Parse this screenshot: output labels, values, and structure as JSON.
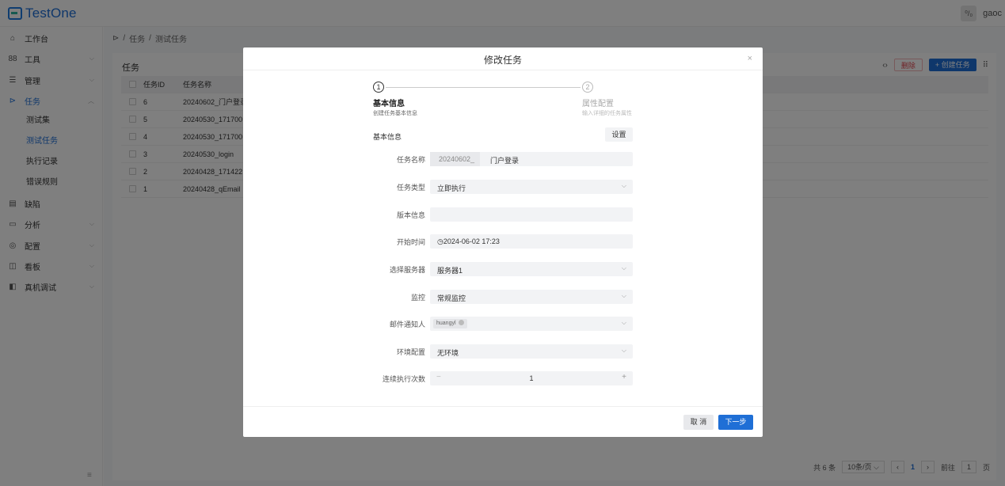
{
  "app": {
    "name": "TestOne",
    "user_avatar": "⁰/₀",
    "user_name": "gaoc"
  },
  "sidebar": {
    "items": [
      {
        "label": "工作台",
        "icon": "home-icon",
        "glyph": "⌂"
      },
      {
        "label": "工具",
        "icon": "grid-icon",
        "glyph": "88"
      },
      {
        "label": "管理",
        "icon": "list-icon",
        "glyph": "☰"
      },
      {
        "label": "任务",
        "icon": "play-icon",
        "glyph": "⊳"
      },
      {
        "label": "缺陷",
        "icon": "document-icon",
        "glyph": "▤"
      },
      {
        "label": "分析",
        "icon": "calendar-icon",
        "glyph": "▭"
      },
      {
        "label": "配置",
        "icon": "settings-icon",
        "glyph": "◎"
      },
      {
        "label": "看板",
        "icon": "board-icon",
        "glyph": "◫"
      },
      {
        "label": "真机调试",
        "icon": "device-icon",
        "glyph": "◧"
      }
    ],
    "task_subitems": [
      "测试集",
      "测试任务",
      "执行记录",
      "错误规则"
    ],
    "collapse_icon": "≡"
  },
  "breadcrumb": {
    "icon": "⊳",
    "sep": "/",
    "items": [
      "任务",
      "测试任务"
    ]
  },
  "card": {
    "title": "任务",
    "code_icon": "‹›",
    "delete_label": "删除",
    "create_label": "+ 创建任务",
    "more_icon": "⠿"
  },
  "table": {
    "headers": {
      "id": "任务ID",
      "name": "任务名称"
    },
    "rows": [
      {
        "id": "6",
        "name": "20240602_门户登录"
      },
      {
        "id": "5",
        "name": "20240530_171700"
      },
      {
        "id": "4",
        "name": "20240530_171700"
      },
      {
        "id": "3",
        "name": "20240530_login"
      },
      {
        "id": "2",
        "name": "20240428_171422"
      },
      {
        "id": "1",
        "name": "20240428_qEmail"
      }
    ]
  },
  "pager": {
    "total": "共 6 条",
    "page_size": "10条/页",
    "prev": "‹",
    "current": "1",
    "next": "›",
    "goto_label": "前往",
    "goto_value": "1",
    "goto_suffix": "页"
  },
  "modal": {
    "title": "修改任务",
    "close": "×",
    "steps": [
      {
        "num": "1",
        "title": "基本信息",
        "desc": "创建任务基本信息"
      },
      {
        "num": "2",
        "title": "属性配置",
        "desc": "输入详细的任务属性"
      }
    ],
    "section_label": "基本信息",
    "settings_label": "设置",
    "fields": {
      "task_name": {
        "label": "任务名称",
        "prefix": "20240602_",
        "value": "门户登录"
      },
      "task_type": {
        "label": "任务类型",
        "value": "立即执行"
      },
      "version": {
        "label": "版本信息",
        "value": ""
      },
      "start_time": {
        "label": "开始时间",
        "value": "◷2024-06-02 17:23"
      },
      "server": {
        "label": "选择服务器",
        "value": "服务器1"
      },
      "monitor": {
        "label": "监控",
        "value": "常规监控"
      },
      "mail_recipient": {
        "label": "邮件通知人",
        "tag": "huangyl"
      },
      "env": {
        "label": "环境配置",
        "value": "无环境"
      },
      "repeat_count": {
        "label": "连续执行次数",
        "minus": "−",
        "value": "1",
        "plus": "+"
      }
    },
    "cancel_label": "取 消",
    "next_label": "下一步"
  },
  "chevron": "⌵"
}
